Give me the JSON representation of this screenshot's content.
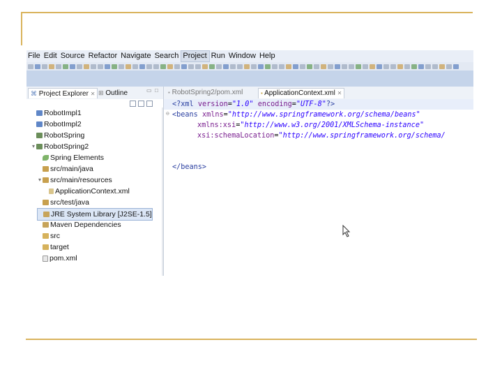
{
  "menu": {
    "items": [
      "File",
      "Edit",
      "Source",
      "Refactor",
      "Navigate",
      "Search",
      "Project",
      "Run",
      "Window",
      "Help"
    ],
    "active_index": 6
  },
  "left_panel": {
    "tab_project_explorer": "Project Explorer",
    "tab_outline": "Outline",
    "tree": [
      {
        "label": "RobotImpl1",
        "icon": "project-icon",
        "level": 0,
        "twisty": ""
      },
      {
        "label": "RobotImpl2",
        "icon": "project-icon",
        "level": 0,
        "twisty": ""
      },
      {
        "label": "RobotSpring",
        "icon": "spring-project-icon",
        "level": 0,
        "twisty": ""
      },
      {
        "label": "RobotSpring2",
        "icon": "spring-project-icon",
        "level": 0,
        "twisty": "▾"
      },
      {
        "label": "Spring Elements",
        "icon": "spring-leaf-icon",
        "level": 1,
        "twisty": ""
      },
      {
        "label": "src/main/java",
        "icon": "source-folder-icon",
        "level": 1,
        "twisty": ""
      },
      {
        "label": "src/main/resources",
        "icon": "source-folder-icon",
        "level": 1,
        "twisty": "▾"
      },
      {
        "label": "ApplicationContext.xml",
        "icon": "xml-file-icon",
        "level": 2,
        "twisty": ""
      },
      {
        "label": "src/test/java",
        "icon": "source-folder-icon",
        "level": 1,
        "twisty": ""
      },
      {
        "label": "JRE System Library [J2SE-1.5]",
        "icon": "library-icon",
        "level": 1,
        "twisty": "",
        "selected": true
      },
      {
        "label": "Maven Dependencies",
        "icon": "library-icon",
        "level": 1,
        "twisty": ""
      },
      {
        "label": "src",
        "icon": "folder-icon",
        "level": 1,
        "twisty": ""
      },
      {
        "label": "target",
        "icon": "folder-icon",
        "level": 1,
        "twisty": ""
      },
      {
        "label": "pom.xml",
        "icon": "file-icon",
        "level": 1,
        "twisty": ""
      }
    ]
  },
  "editor": {
    "tab_inactive": "RobotSpring2/pom.xml",
    "tab_active": "ApplicationContext.xml",
    "lines": {
      "l1_pi_open": "<?xml ",
      "l1_attr1": "version",
      "l1_eq1": "=",
      "l1_val1": "\"1.0\"",
      "l1_attr2": " encoding",
      "l1_eq2": "=",
      "l1_val2": "\"UTF-8\"",
      "l1_pi_close": "?>",
      "l2_tag": "<beans ",
      "l2_attr": "xmlns",
      "l2_eq": "=",
      "l2_val": "\"http://www.springframework.org/schema/beans\"",
      "l3_attr": "xmlns:xsi",
      "l3_eq": "=",
      "l3_val": "\"http://www.w3.org/2001/XMLSchema-instance\"",
      "l4_attr": "xsi:schemaLocation",
      "l4_eq": "=",
      "l4_val": "\"http://www.springframework.org/schema/",
      "l6_tag": "</beans>"
    }
  }
}
